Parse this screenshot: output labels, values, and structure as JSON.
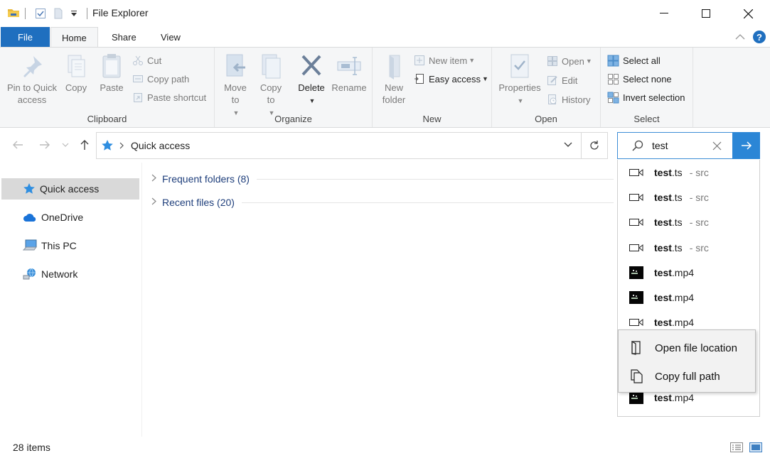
{
  "window": {
    "title": "File Explorer",
    "minimize_icon": "minimize-icon",
    "maximize_icon": "maximize-icon",
    "close_icon": "close-icon"
  },
  "tabs": {
    "file": "File",
    "home": "Home",
    "share": "Share",
    "view": "View",
    "active": "Home"
  },
  "ribbon": {
    "clipboard": {
      "label": "Clipboard",
      "pin_to_quick_access": "Pin to Quick access",
      "copy": "Copy",
      "paste": "Paste",
      "cut": "Cut",
      "copy_path": "Copy path",
      "paste_shortcut": "Paste shortcut"
    },
    "organize": {
      "label": "Organize",
      "move_to": "Move to",
      "copy_to": "Copy to",
      "delete": "Delete",
      "rename": "Rename"
    },
    "new": {
      "label": "New",
      "new_folder": "New folder",
      "new_item": "New item",
      "easy_access": "Easy access"
    },
    "open": {
      "label": "Open",
      "properties": "Properties",
      "open": "Open",
      "edit": "Edit",
      "history": "History"
    },
    "select": {
      "label": "Select",
      "select_all": "Select all",
      "select_none": "Select none",
      "invert_selection": "Invert selection"
    }
  },
  "address": {
    "path": "Quick access"
  },
  "search": {
    "query": "test"
  },
  "navpane": {
    "items": [
      {
        "label": "Quick access",
        "icon": "star-icon",
        "selected": true
      },
      {
        "label": "OneDrive",
        "icon": "cloud-icon",
        "selected": false
      },
      {
        "label": "This PC",
        "icon": "computer-icon",
        "selected": false
      },
      {
        "label": "Network",
        "icon": "network-icon",
        "selected": false
      }
    ]
  },
  "content": {
    "sections": [
      {
        "label": "Frequent folders (8)"
      },
      {
        "label": "Recent files (20)"
      }
    ]
  },
  "suggestions": [
    {
      "match": "test",
      "rest": ".ts",
      "location": "- src",
      "icon": "video-icon"
    },
    {
      "match": "test",
      "rest": ".ts",
      "location": "- src",
      "icon": "video-icon"
    },
    {
      "match": "test",
      "rest": ".ts",
      "location": "- src",
      "icon": "video-icon"
    },
    {
      "match": "test",
      "rest": ".ts",
      "location": "- src",
      "icon": "video-icon"
    },
    {
      "match": "test",
      "rest": ".mp4",
      "location": "",
      "icon": "video-thumbnail"
    },
    {
      "match": "test",
      "rest": ".mp4",
      "location": "",
      "icon": "video-thumbnail"
    },
    {
      "match": "test",
      "rest": ".mp4",
      "location": "",
      "icon": "video-icon"
    },
    {
      "match": "test",
      "rest": ".mp4",
      "location": "",
      "icon": "video-thumbnail"
    }
  ],
  "context_menu": {
    "items": [
      {
        "label": "Open file location",
        "icon": "open-location-icon"
      },
      {
        "label": "Copy full path",
        "icon": "copy-path-icon"
      }
    ]
  },
  "status": {
    "item_count": "28 items"
  },
  "colors": {
    "accent": "#1f6fbf",
    "search_go": "#2b86d6",
    "link_text": "#1e3e7b"
  }
}
